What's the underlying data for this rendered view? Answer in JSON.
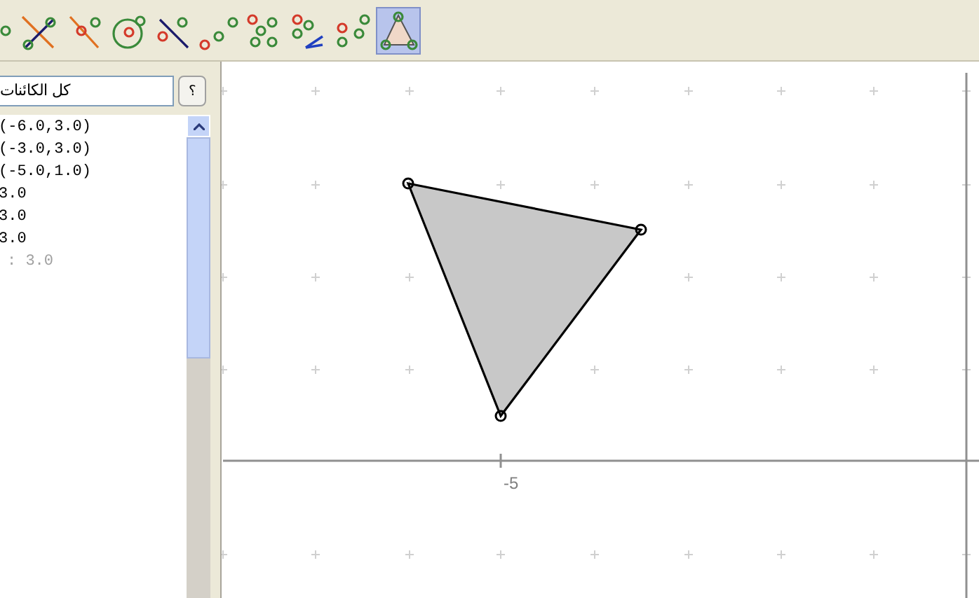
{
  "toolbar": [
    {
      "kind": "point",
      "selected": false
    },
    {
      "kind": "lines",
      "selected": false
    },
    {
      "kind": "perpendicular",
      "selected": false
    },
    {
      "kind": "circle",
      "selected": false
    },
    {
      "kind": "segment",
      "selected": false
    },
    {
      "kind": "dots",
      "selected": false
    },
    {
      "kind": "network",
      "selected": false
    },
    {
      "kind": "angle",
      "selected": false
    },
    {
      "kind": "pairs",
      "selected": false
    },
    {
      "kind": "polygon",
      "selected": true
    }
  ],
  "algebra": {
    "filter": "كل الكائنات",
    "help_button": "؟",
    "items": [
      {
        "text": "(-6.0,3.0)",
        "auxiliary": false
      },
      {
        "text": "(-3.0,3.0)",
        "auxiliary": false
      },
      {
        "text": "(-5.0,1.0)",
        "auxiliary": false
      },
      {
        "text": "3.0",
        "auxiliary": false
      },
      {
        "text": "3.0",
        "auxiliary": false
      },
      {
        "text": "3.0",
        "auxiliary": false
      },
      {
        "text": ": 3.0",
        "auxiliary": true
      }
    ]
  },
  "canvas": {
    "x_tick_label": "-5"
  }
}
